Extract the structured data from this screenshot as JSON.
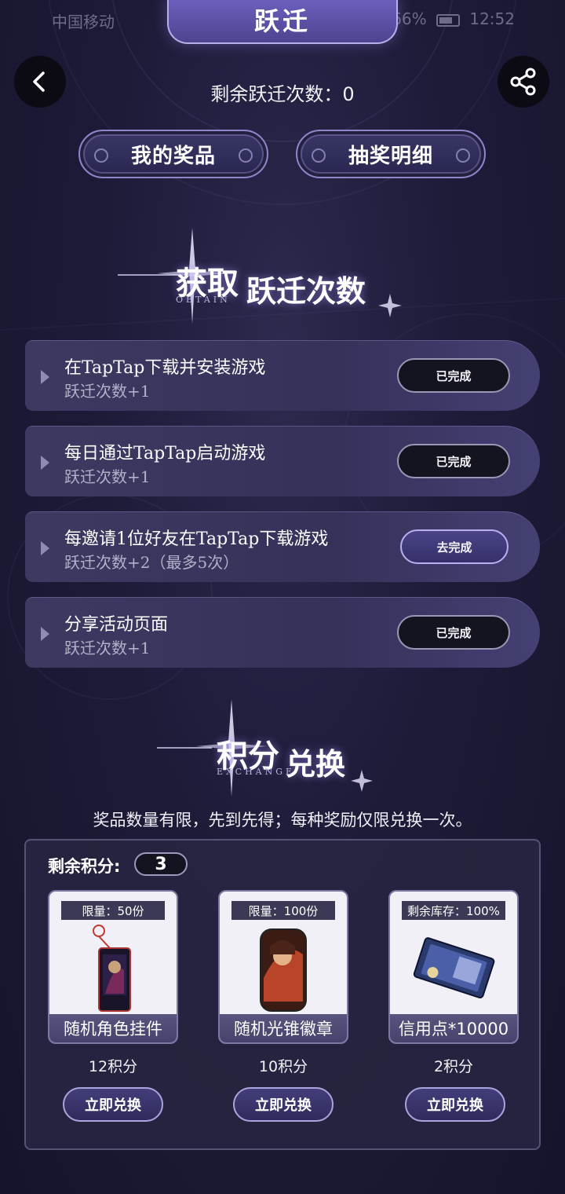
{
  "status_bar": {
    "carrier": "中国移动",
    "battery": "66%",
    "time": "12:52"
  },
  "header": {
    "title": "跃迁",
    "back_icon": "chevron-left-icon",
    "share_icon": "share-icon"
  },
  "remaining_jumps": "剩余跃迁次数：0",
  "top_buttons": {
    "my_prizes": "我的奖品",
    "draw_details": "抽奖明细"
  },
  "obtain_section": {
    "title_a": "获取",
    "title_b": "跃迁次数",
    "subtitle": "OBTAIN",
    "tasks": [
      {
        "title": "在TapTap下载并安装游戏",
        "reward": "跃迁次数+1",
        "button": "已完成"
      },
      {
        "title": "每日通过TapTap启动游戏",
        "reward": "跃迁次数+1",
        "button": "已完成"
      },
      {
        "title": "每邀请1位好友在TapTap下载游戏",
        "reward": "跃迁次数+2（最多5次）",
        "button": "去完成"
      },
      {
        "title": "分享活动页面",
        "reward": "跃迁次数+1",
        "button": "已完成"
      }
    ]
  },
  "exchange_section": {
    "title_a": "积分",
    "title_b": "兑换",
    "subtitle": "EXCHANGE",
    "notice": "奖品数量有限，先到先得；每种奖励仅限兑换一次。",
    "points_label": "剩余积分:",
    "points_value": "3",
    "items": [
      {
        "tag": "限量：50份",
        "name": "随机角色挂件",
        "cost": "12积分",
        "button": "立即兑换"
      },
      {
        "tag": "限量：100份",
        "name": "随机光锥徽章",
        "cost": "10积分",
        "button": "立即兑换"
      },
      {
        "tag": "剩余库存：100%",
        "name": "信用点*10000",
        "cost": "2积分",
        "button": "立即兑换"
      }
    ]
  }
}
